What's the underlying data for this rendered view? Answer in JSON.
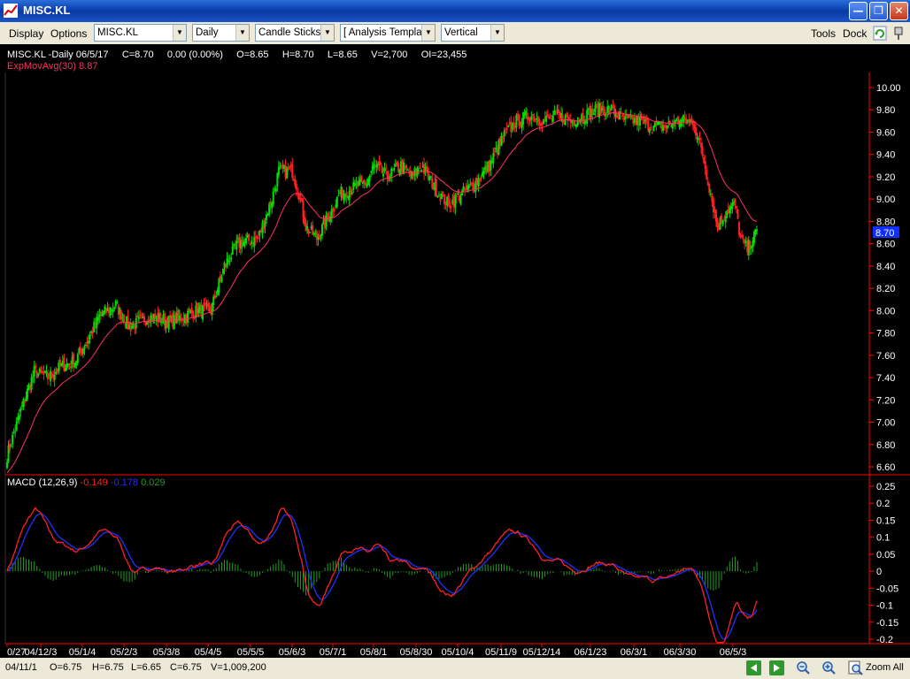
{
  "window": {
    "title": "MISC.KL",
    "minimize_icon": "minimize-icon",
    "maximize_icon": "restore-icon",
    "close_icon": "close-icon"
  },
  "menubar": {
    "display": "Display",
    "options": "Options",
    "symbol": "MISC.KL",
    "period": "Daily",
    "chart_style": "Candle Sticks",
    "template": "[ Analysis Templa",
    "layout": "Vertical",
    "tools": "Tools",
    "dock": "Dock"
  },
  "price_panel": {
    "header": "MISC.KL -Daily  06/5/17",
    "close": "C=8.70",
    "change": "0.00 (0.00%)",
    "open": "O=8.65",
    "high": "H=8.70",
    "low": "L=8.65",
    "volume": "V=2,700",
    "oi": "OI=23,455",
    "ema_label": "ExpMovAvg(30) 8.87",
    "last_price": "8.70"
  },
  "macd_panel": {
    "label": "MACD (12,26,9)",
    "macd_value": "-0.149",
    "signal_value": "-0.178",
    "hist_value": "0.029"
  },
  "x_ticks": [
    "0/27",
    "04/12/3",
    "05/1/4",
    "05/2/3",
    "05/3/8",
    "05/4/5",
    "05/5/5",
    "05/6/3",
    "05/7/1",
    "05/8/1",
    "05/8/30",
    "05/10/4",
    "05/11/9",
    "05/12/14",
    "06/1/23",
    "06/3/1",
    "06/3/30",
    "06/5/3"
  ],
  "status": {
    "date": "04/11/1",
    "open": "O=6.75",
    "high": "H=6.75",
    "low": "L=6.65",
    "close": "C=6.75",
    "volume": "V=1,009,200",
    "zoom_all": "Zoom All"
  },
  "colors": {
    "up": "#00e000",
    "down": "#ff2020",
    "ema": "#ff3060",
    "macd": "#ff2020",
    "signal": "#2030ff",
    "hist": "#20a020",
    "axis": "#ff0000"
  },
  "chart_data": [
    {
      "type": "candlestick",
      "title": "MISC.KL -Daily",
      "ylim": [
        6.55,
        10.15
      ],
      "yticks": [
        "10.00",
        "9.80",
        "9.60",
        "9.40",
        "9.20",
        "9.00",
        "8.80",
        "8.60",
        "8.40",
        "8.20",
        "8.00",
        "7.80",
        "7.60",
        "7.40",
        "7.20",
        "7.00",
        "6.80",
        "6.60"
      ],
      "close_anchors": [
        [
          0,
          6.7
        ],
        [
          10,
          7.1
        ],
        [
          20,
          7.45
        ],
        [
          30,
          7.4
        ],
        [
          40,
          7.5
        ],
        [
          50,
          7.55
        ],
        [
          60,
          7.75
        ],
        [
          68,
          7.95
        ],
        [
          80,
          8.05
        ],
        [
          90,
          7.85
        ],
        [
          105,
          7.95
        ],
        [
          120,
          7.9
        ],
        [
          140,
          8.0
        ],
        [
          150,
          8.0
        ],
        [
          160,
          8.4
        ],
        [
          170,
          8.6
        ],
        [
          185,
          8.65
        ],
        [
          195,
          9.0
        ],
        [
          200,
          9.25
        ],
        [
          210,
          9.25
        ],
        [
          215,
          9.05
        ],
        [
          220,
          8.75
        ],
        [
          228,
          8.65
        ],
        [
          235,
          8.8
        ],
        [
          245,
          9.05
        ],
        [
          255,
          9.1
        ],
        [
          265,
          9.15
        ],
        [
          270,
          9.3
        ],
        [
          280,
          9.2
        ],
        [
          290,
          9.3
        ],
        [
          298,
          9.2
        ],
        [
          305,
          9.3
        ],
        [
          315,
          9.1
        ],
        [
          325,
          8.95
        ],
        [
          335,
          9.05
        ],
        [
          345,
          9.15
        ],
        [
          355,
          9.3
        ],
        [
          365,
          9.55
        ],
        [
          375,
          9.7
        ],
        [
          385,
          9.75
        ],
        [
          395,
          9.7
        ],
        [
          405,
          9.75
        ],
        [
          415,
          9.7
        ],
        [
          425,
          9.75
        ],
        [
          435,
          9.8
        ],
        [
          445,
          9.8
        ],
        [
          455,
          9.7
        ],
        [
          465,
          9.7
        ],
        [
          475,
          9.65
        ],
        [
          485,
          9.65
        ],
        [
          495,
          9.7
        ],
        [
          505,
          9.7
        ],
        [
          512,
          9.4
        ],
        [
          518,
          9.05
        ],
        [
          523,
          8.75
        ],
        [
          530,
          8.9
        ],
        [
          536,
          8.95
        ],
        [
          540,
          8.65
        ],
        [
          545,
          8.55
        ],
        [
          549,
          8.65
        ],
        [
          552,
          8.7
        ]
      ],
      "ema_label": "ExpMovAvg(30)",
      "last": {
        "date": "06/5/17",
        "open": 8.65,
        "high": 8.7,
        "low": 8.65,
        "close": 8.7,
        "volume": 2700,
        "open_interest": 23455,
        "ema30": 8.87
      }
    },
    {
      "type": "line",
      "title": "MACD (12,26,9)",
      "ylim": [
        -0.21,
        0.27
      ],
      "yticks": [
        "0.25",
        "0.2",
        "0.15",
        "0.1",
        "0.05",
        "0",
        "-0.05",
        "-0.1",
        "-0.15",
        "-0.2"
      ],
      "series": [
        {
          "name": "MACD",
          "last": -0.149
        },
        {
          "name": "Signal",
          "last": -0.178
        },
        {
          "name": "Histogram",
          "last": 0.029
        }
      ]
    }
  ]
}
